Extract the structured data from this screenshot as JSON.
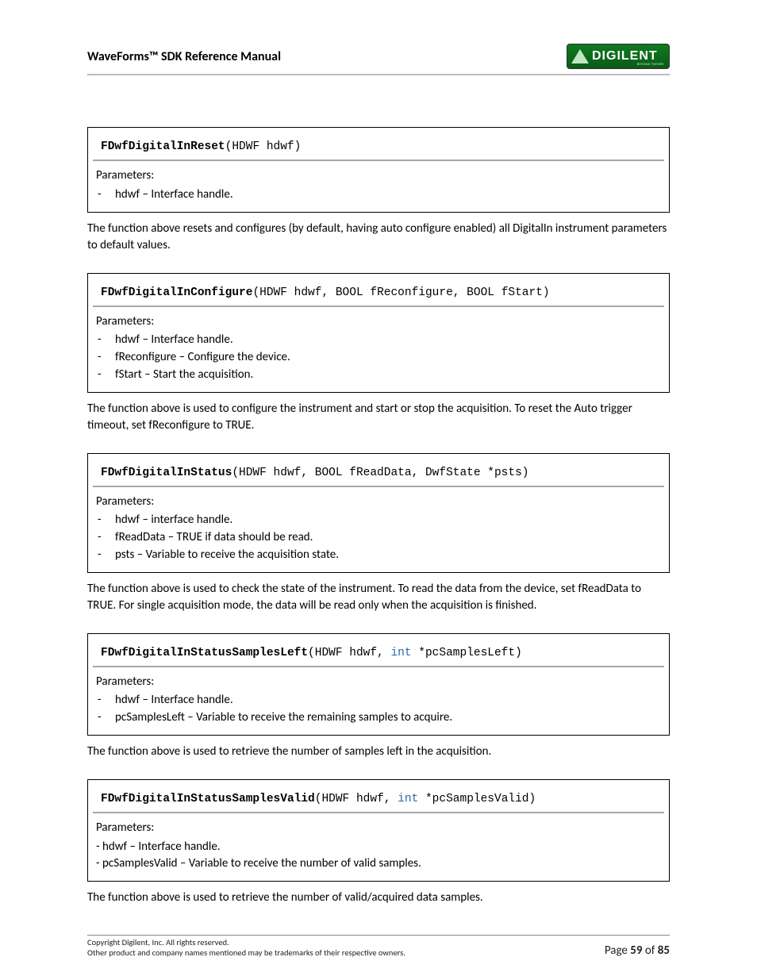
{
  "header": {
    "title": "WaveForms™ SDK Reference Manual",
    "logo_text": "DIGILENT",
    "logo_sub": "BEYOND THEORY"
  },
  "functions": [
    {
      "name": "FDwfDigitalInReset",
      "args_plain": "(HDWF hdwf)",
      "args_pre_kw": "",
      "kw": "",
      "args_post_kw": "",
      "params_label": "Parameters:",
      "params": [
        "hdwf – Interface handle."
      ],
      "desc": "The function above resets and configures (by default, having auto configure enabled) all DigitalIn instrument parameters to default values."
    },
    {
      "name": "FDwfDigitalInConfigure",
      "args_plain": "(HDWF hdwf, BOOL fReconfigure, BOOL fStart)",
      "args_pre_kw": "",
      "kw": "",
      "args_post_kw": "",
      "params_label": "Parameters:",
      "params": [
        "hdwf – Interface handle.",
        "fReconfigure – Configure the device.",
        "fStart – Start the acquisition."
      ],
      "desc": "The function above is used to configure the instrument and start or stop the acquisition. To reset the Auto trigger timeout, set fReconfigure to TRUE."
    },
    {
      "name": "FDwfDigitalInStatus",
      "args_plain": "(HDWF hdwf, BOOL fReadData, DwfState *psts)",
      "args_pre_kw": "",
      "kw": "",
      "args_post_kw": "",
      "params_label": "Parameters:",
      "params": [
        "hdwf – interface handle.",
        "fReadData – TRUE if data should be read.",
        "psts – Variable to receive the acquisition state."
      ],
      "desc": "The function above is used to check the state of the instrument. To read the data from the device, set fReadData to TRUE. For single acquisition mode, the data will be read only when the acquisition is finished."
    },
    {
      "name": "FDwfDigitalInStatusSamplesLeft",
      "args_plain": "",
      "args_pre_kw": "(HDWF hdwf, ",
      "kw": "int",
      "args_post_kw": " *pcSamplesLeft)",
      "params_label": "Parameters:",
      "params": [
        "hdwf – Interface handle.",
        "pcSamplesLeft – Variable to receive the remaining samples to acquire."
      ],
      "desc": "The function above is used to retrieve the number of samples left in the acquisition."
    },
    {
      "name": "FDwfDigitalInStatusSamplesValid",
      "args_plain": "",
      "args_pre_kw": "(HDWF hdwf, ",
      "kw": "int",
      "args_post_kw": " *pcSamplesValid)",
      "params_label": "Parameters:",
      "params_inline": [
        "- hdwf – Interface handle.",
        "- pcSamplesValid – Variable to receive the number of valid samples."
      ],
      "desc": "The function above is used to retrieve the number of valid/acquired data samples."
    }
  ],
  "footer": {
    "copyright": "Copyright Digilent, Inc. All rights reserved.",
    "trademark": "Other product and company names mentioned may be trademarks of their respective owners.",
    "page_word": "Page ",
    "page_num": "59",
    "page_of": " of ",
    "page_total": "85"
  }
}
